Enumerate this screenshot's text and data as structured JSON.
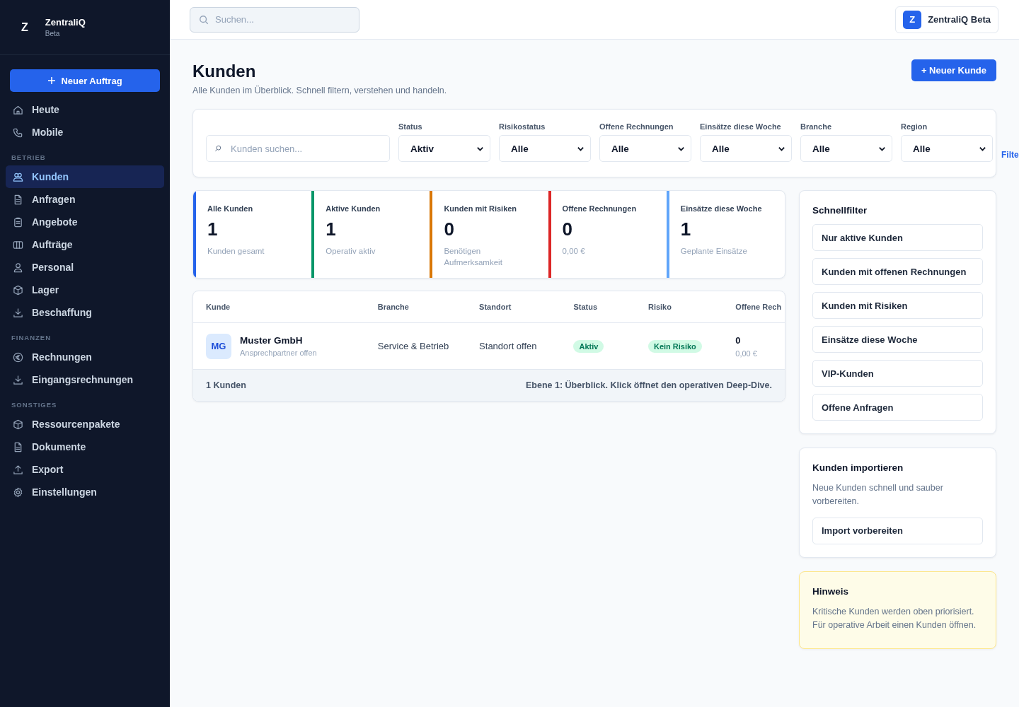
{
  "brand": {
    "logo": "Z",
    "name": "ZentraliQ",
    "sub": "Beta"
  },
  "sidebar": {
    "primary_button": "Neuer Auftrag",
    "groups": [
      {
        "items": [
          {
            "label": "Heute",
            "selected": false
          },
          {
            "label": "Mobile",
            "selected": false
          }
        ]
      },
      {
        "heading": "BETRIEB",
        "items": [
          {
            "label": "Kunden",
            "selected": true
          },
          {
            "label": "Anfragen",
            "selected": false
          },
          {
            "label": "Angebote",
            "selected": false
          },
          {
            "label": "Aufträge",
            "selected": false
          },
          {
            "label": "Personal",
            "selected": false
          },
          {
            "label": "Lager",
            "selected": false
          },
          {
            "label": "Beschaffung",
            "selected": false
          }
        ]
      },
      {
        "heading": "FINANZEN",
        "items": [
          {
            "label": "Rechnungen",
            "selected": false
          },
          {
            "label": "Eingangsrechnungen",
            "selected": false
          }
        ]
      },
      {
        "heading": "SONSTIGES",
        "items": [
          {
            "label": "Ressourcenpakete",
            "selected": false
          },
          {
            "label": "Dokumente",
            "selected": false
          },
          {
            "label": "Export",
            "selected": false
          },
          {
            "label": "Einstellungen",
            "selected": false
          }
        ]
      }
    ]
  },
  "topbar": {
    "search": {
      "placeholder": "Suchen..."
    },
    "account": {
      "avatar": "Z",
      "name": "ZentraliQ Beta"
    }
  },
  "page": {
    "title": "Kunden",
    "subtitle": "Alle Kunden im Überblick. Schnell filtern, verstehen und handeln.",
    "action": "+ Neuer Kunde"
  },
  "filters": {
    "search": {
      "placeholder": "Kunden suchen..."
    },
    "selects": [
      {
        "label": "Status",
        "value": "Aktiv"
      },
      {
        "label": "Risikostatus",
        "value": "Alle"
      },
      {
        "label": "Offene Rechnungen",
        "value": "Alle"
      },
      {
        "label": "Einsätze diese Woche",
        "value": "Alle"
      },
      {
        "label": "Branche",
        "value": "Alle"
      },
      {
        "label": "Region",
        "value": "Alle"
      }
    ],
    "link": "Filte"
  },
  "stats": [
    {
      "title": "Alle Kunden",
      "value": "1",
      "note": "Kunden gesamt",
      "color": "#2563eb"
    },
    {
      "title": "Aktive Kunden",
      "value": "1",
      "note": "Operativ aktiv",
      "color": "#059669"
    },
    {
      "title": "Kunden mit Risiken",
      "value": "0",
      "note": "Benötigen Aufmerksamkeit",
      "color": "#d97706"
    },
    {
      "title": "Offene Rechnungen",
      "value": "0",
      "note": "0,00 €",
      "color": "#dc2626"
    },
    {
      "title": "Einsätze diese Woche",
      "value": "1",
      "note": "Geplante Einsätze",
      "color": "#60a5fa"
    }
  ],
  "table": {
    "columns": [
      "Kunde",
      "Branche",
      "Standort",
      "Status",
      "Risiko",
      "Offene Rech"
    ],
    "rows": [
      {
        "initials": "MG",
        "name": "Muster GmbH",
        "contact": "Ansprechpartner offen",
        "branche": "Service & Betrieb",
        "standort": "Standort offen",
        "status": "Aktiv",
        "risiko": "Kein Risiko",
        "open_count": "0",
        "open_amount": "0,00 €"
      }
    ],
    "footer_count": "1 Kunden",
    "footer_note": "Ebene 1: Überblick. Klick öffnet den operativen Deep-Dive."
  },
  "quick_filters": {
    "title": "Schnellfilter",
    "buttons": [
      "Nur aktive Kunden",
      "Kunden mit offenen Rechnungen",
      "Kunden mit Risiken",
      "Einsätze diese Woche",
      "VIP-Kunden",
      "Offene Anfragen"
    ]
  },
  "import": {
    "title": "Kunden importieren",
    "text": "Neue Kunden schnell und sauber vorbereiten.",
    "button": "Import vorbereiten"
  },
  "hint": {
    "title": "Hinweis",
    "text": "Kritische Kunden werden oben priorisiert. Für operative Arbeit einen Kunden öffnen."
  }
}
